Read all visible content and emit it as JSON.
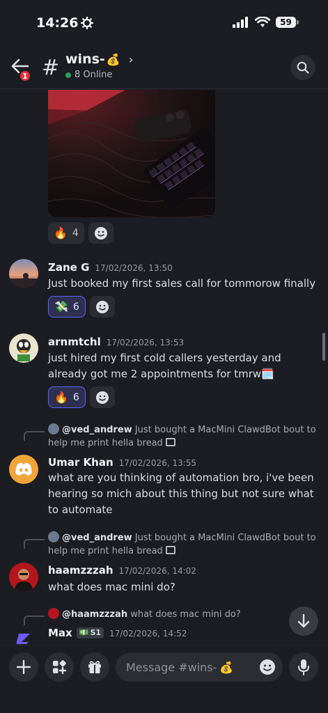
{
  "status_bar": {
    "time": "14:26",
    "battery": "59"
  },
  "header": {
    "back_badge": "1",
    "channel_name": "wins-",
    "channel_emoji": "💰",
    "online": "8 Online"
  },
  "feed": {
    "first_reactions": [
      {
        "emoji": "🔥",
        "count": "4"
      }
    ],
    "messages": [
      {
        "author": "Zane G",
        "timestamp": "17/02/2026, 13:50",
        "text": "Just booked my first sales call for tommorow finally",
        "reactions": [
          {
            "emoji": "💸",
            "count": "6"
          }
        ]
      },
      {
        "author": "arnmtchl",
        "timestamp": "17/02/2026, 13:53",
        "text": "just hired my first cold callers yesterday and already got me 2 appointments for tmrw🗓️",
        "reactions": [
          {
            "emoji": "🔥",
            "count": "6"
          }
        ]
      },
      {
        "reply_author": "@ved_andrew",
        "reply_text": "Just bought a MacMini ClawdBot bout to help me print hella bread",
        "author": "Umar Khan",
        "timestamp": "17/02/2026, 13:55",
        "text": "what are you thinking of automation bro, i've been hearing so mich about this thing but not sure what to automate"
      },
      {
        "reply_author": "@ved_andrew",
        "reply_text": "Just bought a MacMini ClawdBot bout to help me print hella bread",
        "author": "haamzzzah",
        "timestamp": "17/02/2026, 14:02",
        "text": "what does mac mini do?"
      },
      {
        "reply_author": "@haamzzzah",
        "reply_text": "what does mac mini do?",
        "author": "Max",
        "badge": "S1",
        "timestamp": "17/02/2026, 14:52"
      }
    ]
  },
  "composer": {
    "placeholder": "Message #wins-",
    "placeholder_emoji": "💰"
  },
  "colors": {
    "background": "#1c1d23",
    "accent": "#5865f2",
    "online": "#23a55a",
    "badge": "#e0303c"
  }
}
